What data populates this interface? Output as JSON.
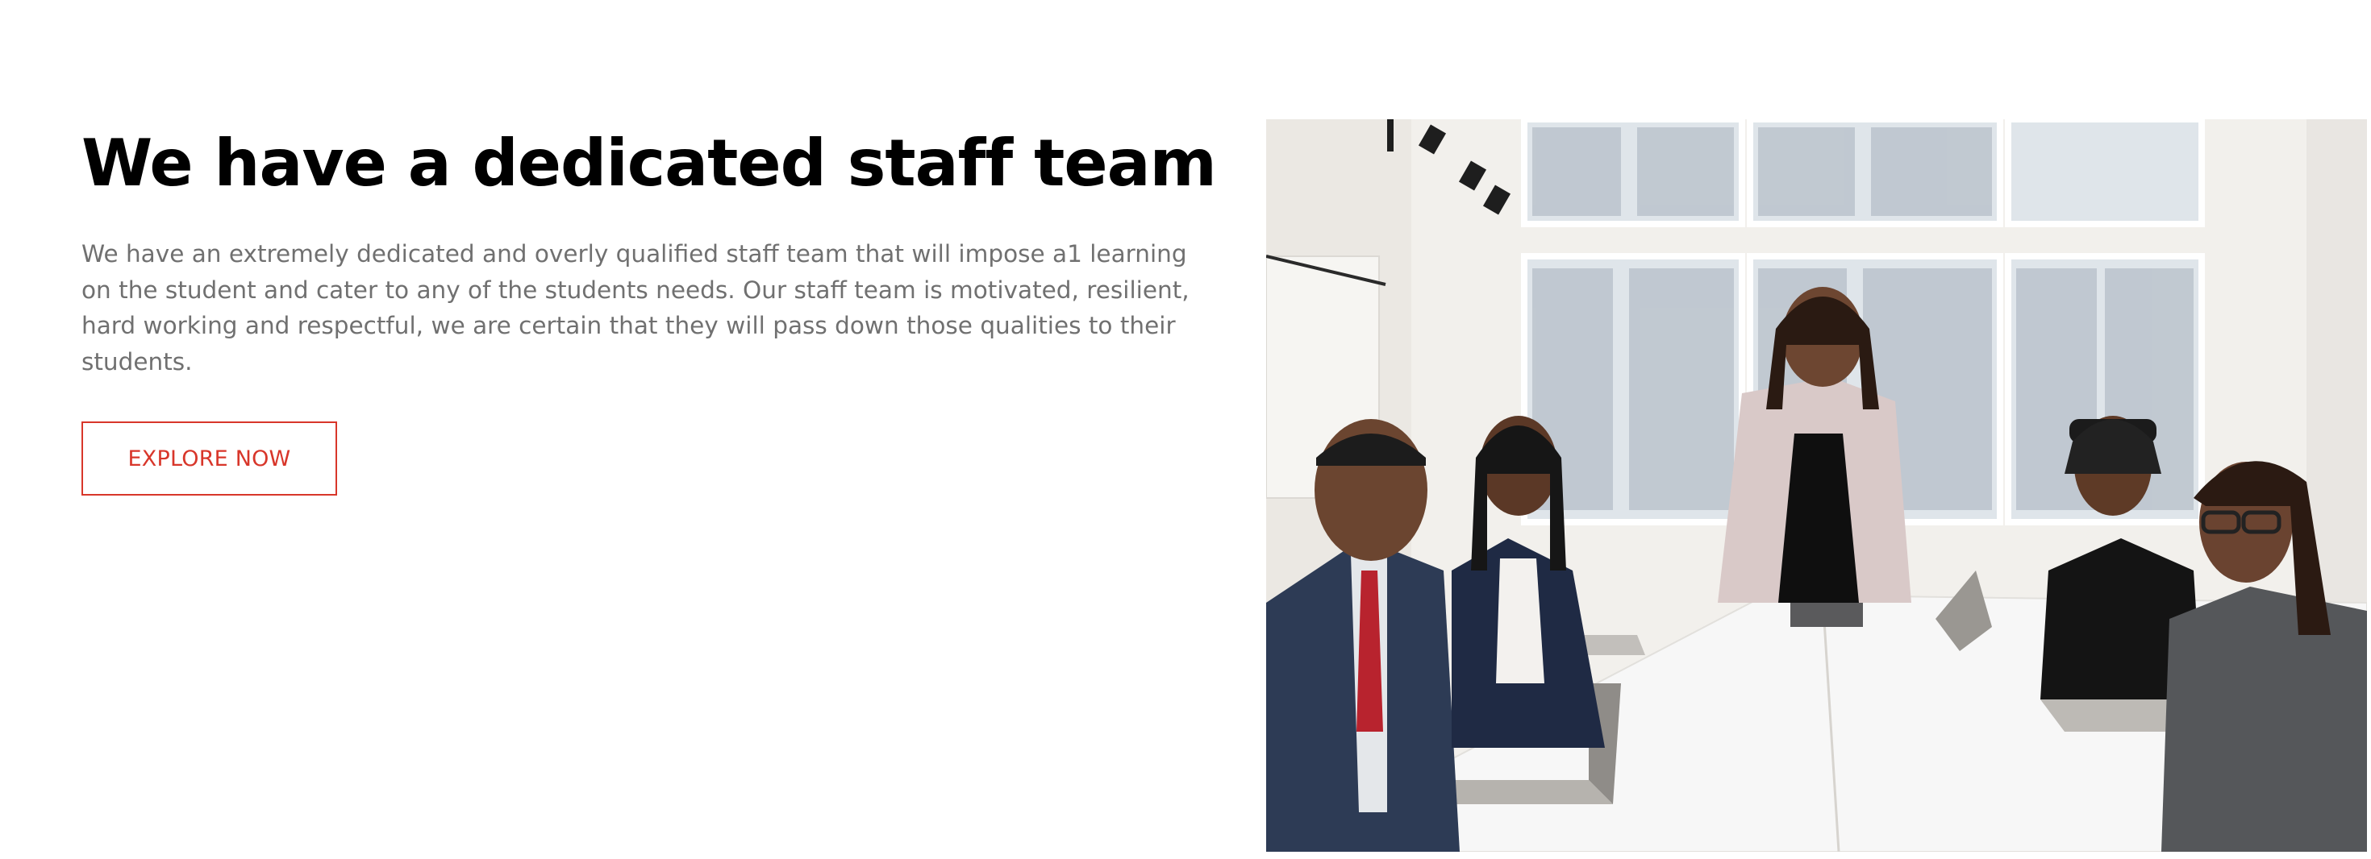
{
  "section": {
    "heading": "We have a dedicated staff team",
    "paragraph": "We have an extremely dedicated and overly qualified staff team that will impose a1 learning on the student and cater to any of the students needs. Our staff team is motivated, resilient, hard working and respectful, we are certain that they will pass down those qualities to their students.",
    "cta_label": "EXPLORE NOW"
  },
  "colors": {
    "accent": "#d8362a",
    "heading": "#000000",
    "body_text": "#707070",
    "background": "#ffffff"
  },
  "photo": {
    "icon": "team-meeting-photo"
  }
}
